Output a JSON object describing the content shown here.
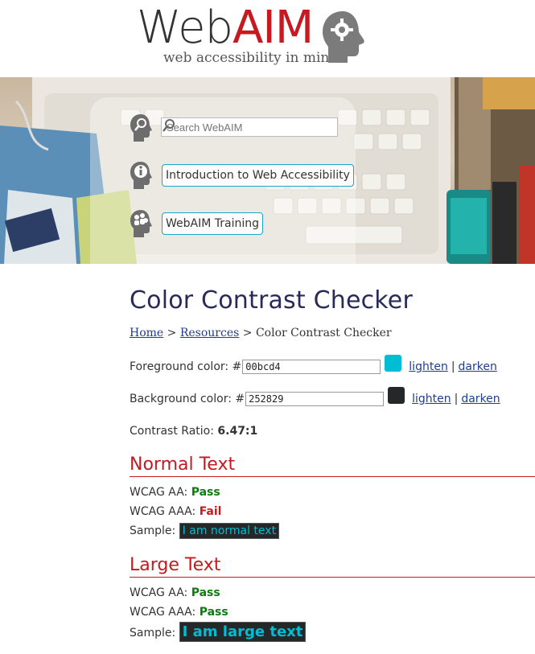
{
  "header": {
    "logo_web": "Web",
    "logo_aim": "AIM",
    "tagline": "web accessibility in mind"
  },
  "banner": {
    "search_placeholder": "Search WebAIM",
    "links": [
      {
        "label": "Introduction to Web Accessibility"
      },
      {
        "label": "WebAIM Training"
      }
    ]
  },
  "page": {
    "title": "Color Contrast Checker",
    "breadcrumb": {
      "home": "Home",
      "sep1": ">",
      "resources": "Resources",
      "sep2": ">",
      "current": "Color Contrast Checker"
    }
  },
  "form": {
    "fg_label": "Foreground color: #",
    "fg_value": "00bcd4",
    "bg_label": "Background color: #",
    "bg_value": "252829",
    "lighten": "lighten",
    "pipe": "|",
    "darken": "darken",
    "ratio_label": "Contrast Ratio:",
    "ratio_value": "6.47:1"
  },
  "normal": {
    "heading": "Normal Text",
    "aa_label": "WCAG AA:",
    "aa_result": "Pass",
    "aaa_label": "WCAG AAA:",
    "aaa_result": "Fail",
    "sample_label": "Sample:",
    "sample_text": "I am normal text"
  },
  "large": {
    "heading": "Large Text",
    "aa_label": "WCAG AA:",
    "aa_result": "Pass",
    "aaa_label": "WCAG AAA:",
    "aaa_result": "Pass",
    "sample_label": "Sample:",
    "sample_text": "I am large text"
  },
  "colors": {
    "foreground": "#00bcd4",
    "background": "#252829",
    "brand_red": "#c41a20",
    "pass_green": "#107a10"
  },
  "icons": [
    "gear-head-icon",
    "search-pin-icon",
    "magnifier-icon",
    "info-pin-icon",
    "training-pin-icon"
  ]
}
